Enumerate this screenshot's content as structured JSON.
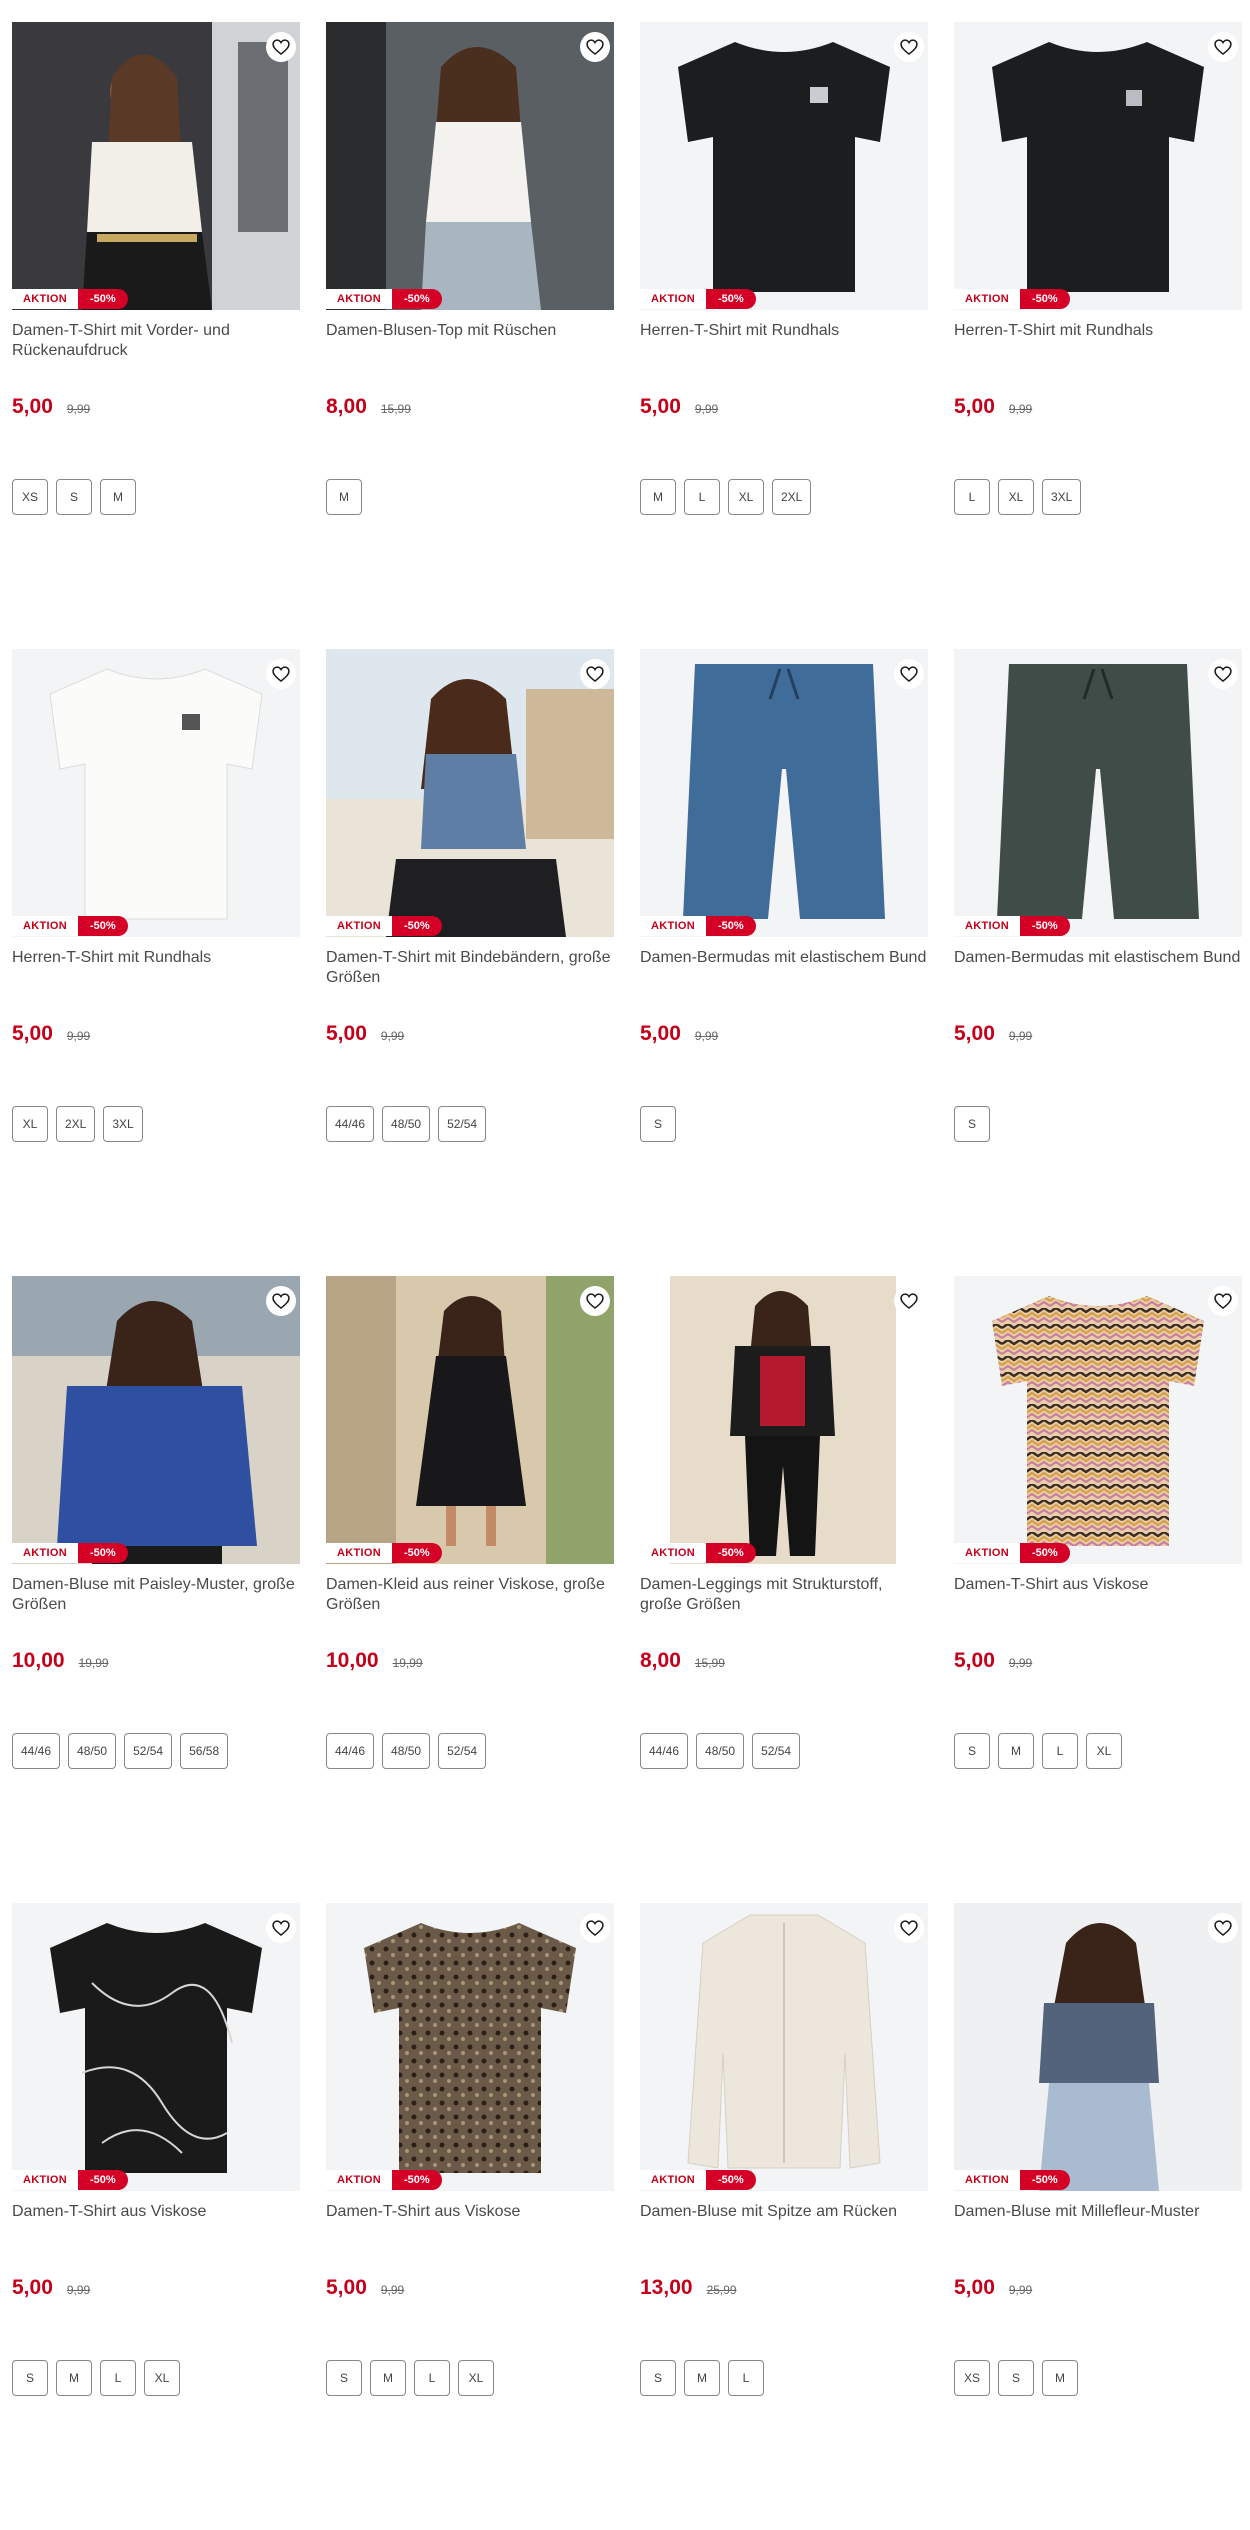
{
  "badges": {
    "aktion": "AKTION",
    "discount": "-50%"
  },
  "colors": {
    "accent": "#c4001a",
    "discount_bg": "#d40025"
  },
  "products": [
    {
      "title": "Damen-T-Shirt mit Vorder- und Rückenaufdruck",
      "price": "5,00",
      "old_price": "9,99",
      "sizes": [
        "XS",
        "S",
        "M"
      ],
      "image": "woman-white-tshirt-photo",
      "icon": "heart-icon"
    },
    {
      "title": "Damen-Blusen-Top mit Rüschen",
      "price": "8,00",
      "old_price": "15,99",
      "sizes": [
        "M"
      ],
      "image": "woman-white-ruffle-top-photo",
      "icon": "heart-icon"
    },
    {
      "title": "Herren-T-Shirt mit Rundhals",
      "price": "5,00",
      "old_price": "9,99",
      "sizes": [
        "M",
        "L",
        "XL",
        "2XL"
      ],
      "image": "black-tshirt-photo",
      "icon": "heart-icon"
    },
    {
      "title": "Herren-T-Shirt mit Rundhals",
      "price": "5,00",
      "old_price": "9,99",
      "sizes": [
        "L",
        "XL",
        "3XL"
      ],
      "image": "black-tshirt-photo",
      "icon": "heart-icon"
    },
    {
      "title": "Herren-T-Shirt mit Rundhals",
      "price": "5,00",
      "old_price": "9,99",
      "sizes": [
        "XL",
        "2XL",
        "3XL"
      ],
      "image": "white-tshirt-photo",
      "icon": "heart-icon"
    },
    {
      "title": "Damen-T-Shirt mit Bindebändern, große Größen",
      "price": "5,00",
      "old_price": "9,99",
      "sizes": [
        "44/46",
        "48/50",
        "52/54"
      ],
      "image": "woman-blue-shirt-photo",
      "icon": "heart-icon"
    },
    {
      "title": "Damen-Bermudas mit elastischem Bund",
      "price": "5,00",
      "old_price": "9,99",
      "sizes": [
        "S"
      ],
      "image": "blue-bermudas-photo",
      "icon": "heart-icon"
    },
    {
      "title": "Damen-Bermudas mit elastischem Bund",
      "price": "5,00",
      "old_price": "9,99",
      "sizes": [
        "S"
      ],
      "image": "green-bermudas-photo",
      "icon": "heart-icon"
    },
    {
      "title": "Damen-Bluse mit Paisley-Muster, große Größen",
      "price": "10,00",
      "old_price": "19,99",
      "sizes": [
        "44/46",
        "48/50",
        "52/54",
        "56/58"
      ],
      "image": "woman-blue-paisley-blouse-photo",
      "icon": "heart-icon"
    },
    {
      "title": "Damen-Kleid aus reiner Viskose, große Größen",
      "price": "10,00",
      "old_price": "19,99",
      "sizes": [
        "44/46",
        "48/50",
        "52/54"
      ],
      "image": "woman-black-dress-photo",
      "icon": "heart-icon"
    },
    {
      "title": "Damen-Leggings mit Strukturstoff, große Größen",
      "price": "8,00",
      "old_price": "15,99",
      "sizes": [
        "44/46",
        "48/50",
        "52/54"
      ],
      "image": "woman-black-leggings-photo",
      "icon": "heart-icon"
    },
    {
      "title": "Damen-T-Shirt aus Viskose",
      "price": "5,00",
      "old_price": "9,99",
      "sizes": [
        "S",
        "M",
        "L",
        "XL"
      ],
      "image": "zigzag-tshirt-photo",
      "icon": "heart-icon"
    },
    {
      "title": "Damen-T-Shirt aus Viskose",
      "price": "5,00",
      "old_price": "9,99",
      "sizes": [
        "S",
        "M",
        "L",
        "XL"
      ],
      "image": "black-floral-tshirt-photo",
      "icon": "heart-icon"
    },
    {
      "title": "Damen-T-Shirt aus Viskose",
      "price": "5,00",
      "old_price": "9,99",
      "sizes": [
        "S",
        "M",
        "L",
        "XL"
      ],
      "image": "brown-print-tshirt-photo",
      "icon": "heart-icon"
    },
    {
      "title": "Damen-Bluse mit Spitze am Rücken",
      "price": "13,00",
      "old_price": "25,99",
      "sizes": [
        "S",
        "M",
        "L"
      ],
      "image": "cream-blouse-photo",
      "icon": "heart-icon"
    },
    {
      "title": "Damen-Bluse mit Millefleur-Muster",
      "price": "5,00",
      "old_price": "9,99",
      "sizes": [
        "XS",
        "S",
        "M"
      ],
      "image": "woman-blue-millefleur-blouse-photo",
      "icon": "heart-icon"
    }
  ]
}
